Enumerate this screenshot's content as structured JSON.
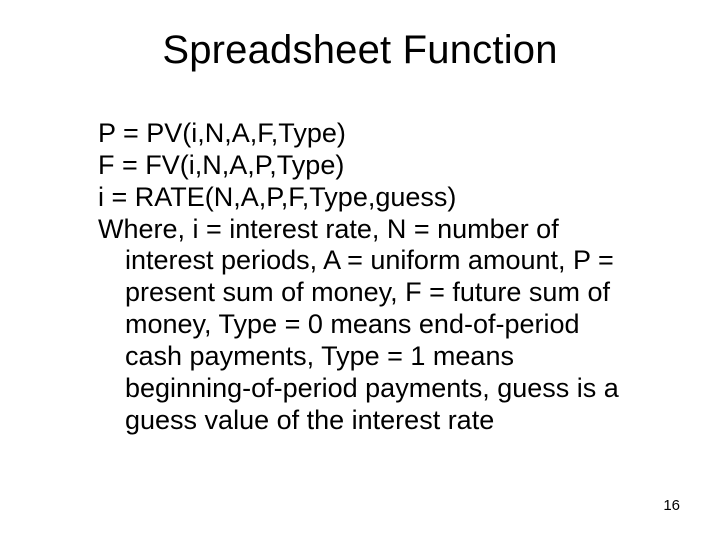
{
  "title": "Spreadsheet Function",
  "lines": {
    "l1": "P = PV(i,N,A,F,Type)",
    "l2": "F =  FV(i,N,A,P,Type)",
    "l3": "i = RATE(N,A,P,F,Type,guess)",
    "l4": "Where, i = interest rate, N = number of interest periods, A = uniform amount, P = present sum of money, F = future sum of money, Type = 0 means end-of-period cash payments, Type = 1 means beginning-of-period payments, guess is a guess value of the interest rate"
  },
  "page_number": "16"
}
